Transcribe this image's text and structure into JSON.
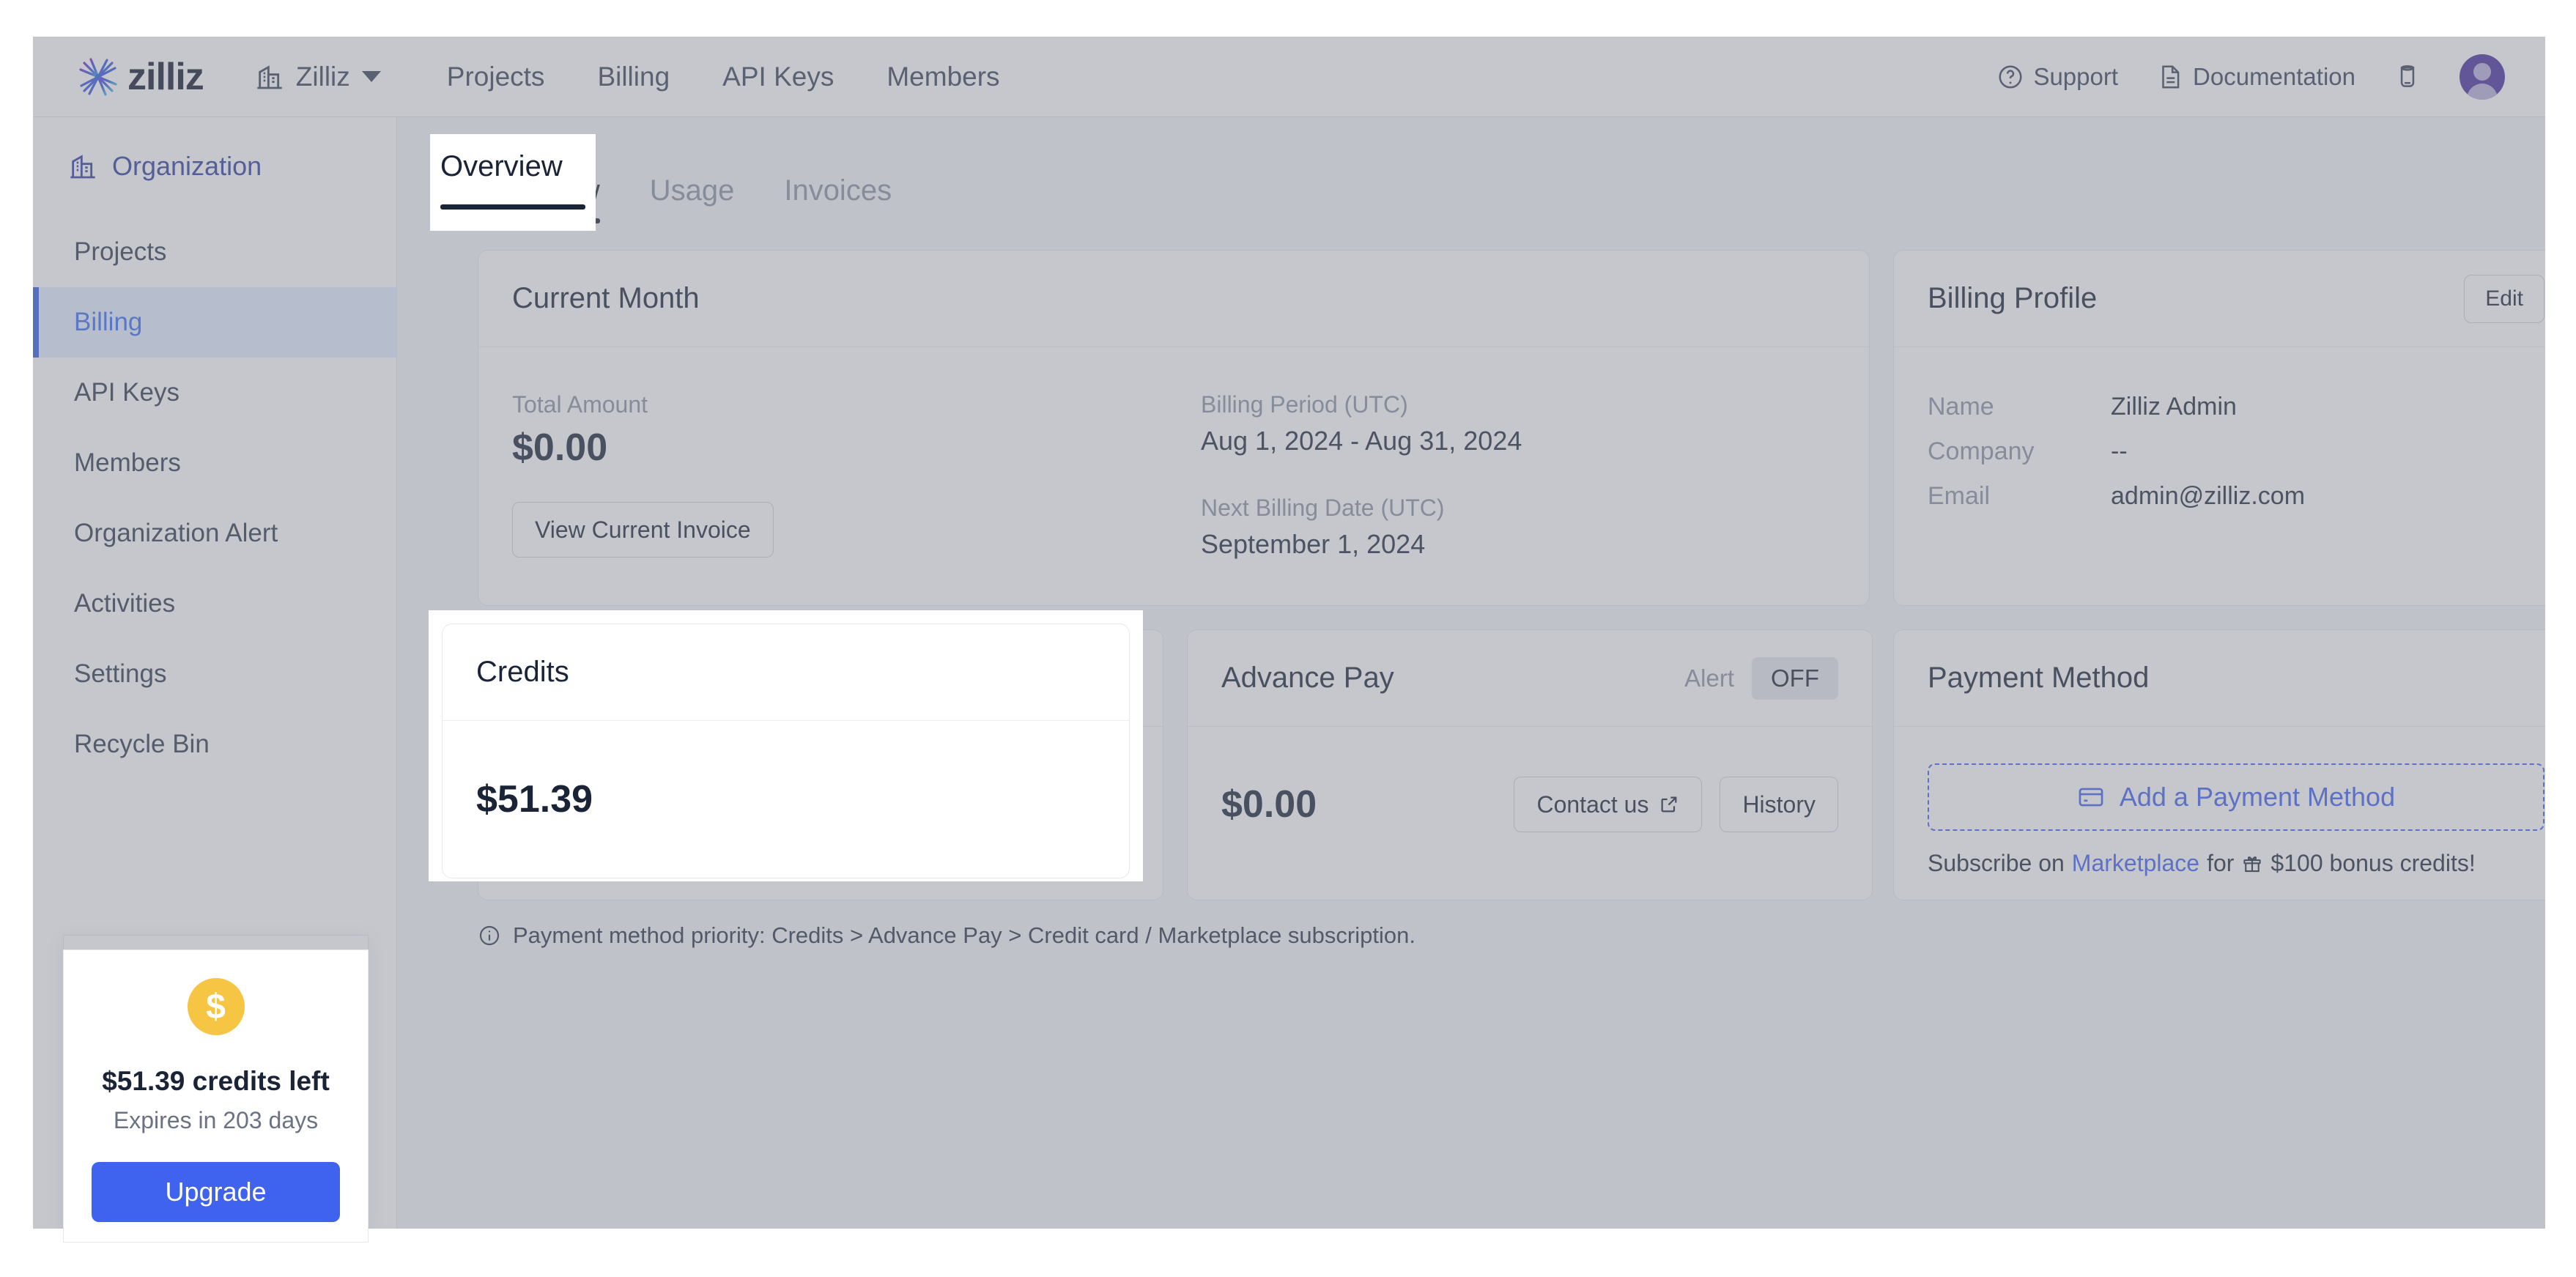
{
  "header": {
    "logo_text": "zilliz",
    "logo_icon": "zilliz-starburst-icon",
    "org_icon": "building-icon",
    "org_name": "Zilliz",
    "caret_icon": "chevron-down-icon",
    "nav": [
      {
        "label": "Projects"
      },
      {
        "label": "Billing"
      },
      {
        "label": "API Keys"
      },
      {
        "label": "Members"
      }
    ],
    "support": {
      "label": "Support",
      "icon": "question-circle-icon"
    },
    "documentation": {
      "label": "Documentation",
      "icon": "document-icon"
    },
    "cup_icon": "cup-icon",
    "avatar_icon": "user-avatar",
    "avatar_color": "#4b2f9e"
  },
  "sidebar": {
    "org_label": "Organization",
    "org_icon": "building-icon",
    "items": [
      {
        "label": "Projects",
        "active": false
      },
      {
        "label": "Billing",
        "active": true
      },
      {
        "label": "API Keys",
        "active": false
      },
      {
        "label": "Members",
        "active": false
      },
      {
        "label": "Organization Alert",
        "active": false
      },
      {
        "label": "Activities",
        "active": false
      },
      {
        "label": "Settings",
        "active": false
      },
      {
        "label": "Recycle Bin",
        "active": false
      }
    ],
    "active_color": "#3b6ef0",
    "active_bg": "#e4edfd",
    "promo": {
      "coin_icon": "dollar-coin-icon",
      "coin_symbol": "$",
      "coin_color": "#f6c544",
      "title": "$51.39 credits left",
      "subtitle": "Expires in 203 days",
      "button_label": "Upgrade",
      "button_color": "#3f63ef"
    }
  },
  "tabs": [
    {
      "label": "Overview",
      "active": true
    },
    {
      "label": "Usage",
      "active": false
    },
    {
      "label": "Invoices",
      "active": false
    }
  ],
  "cards": {
    "current_month": {
      "title": "Current Month",
      "total_amount_label": "Total Amount",
      "total_amount_value": "$0.00",
      "view_invoice_label": "View Current Invoice",
      "billing_period_label": "Billing Period (UTC)",
      "billing_period_value": "Aug 1, 2024 - Aug 31, 2024",
      "next_billing_label": "Next Billing Date (UTC)",
      "next_billing_value": "September 1, 2024"
    },
    "billing_profile": {
      "title": "Billing Profile",
      "edit_label": "Edit",
      "name_label": "Name",
      "name_value": "Zilliz Admin",
      "company_label": "Company",
      "company_value": "--",
      "email_label": "Email",
      "email_value": "admin@zilliz.com"
    },
    "credits": {
      "title": "Credits",
      "value": "$51.39"
    },
    "advance_pay": {
      "title": "Advance Pay",
      "alert_label": "Alert",
      "alert_state": "OFF",
      "value": "$0.00",
      "contact_label": "Contact us",
      "contact_icon": "external-link-icon",
      "history_label": "History"
    },
    "payment_method": {
      "title": "Payment Method",
      "add_label": "Add a Payment Method",
      "add_icon": "credit-card-icon",
      "subscribe_prefix": "Subscribe on",
      "subscribe_link": "Marketplace",
      "subscribe_mid": "for",
      "gift_icon": "gift-icon",
      "subscribe_suffix": "$100 bonus credits!"
    }
  },
  "footnote": {
    "icon": "info-circle-icon",
    "text": "Payment method priority: Credits > Advance Pay > Credit card / Marketplace subscription."
  }
}
